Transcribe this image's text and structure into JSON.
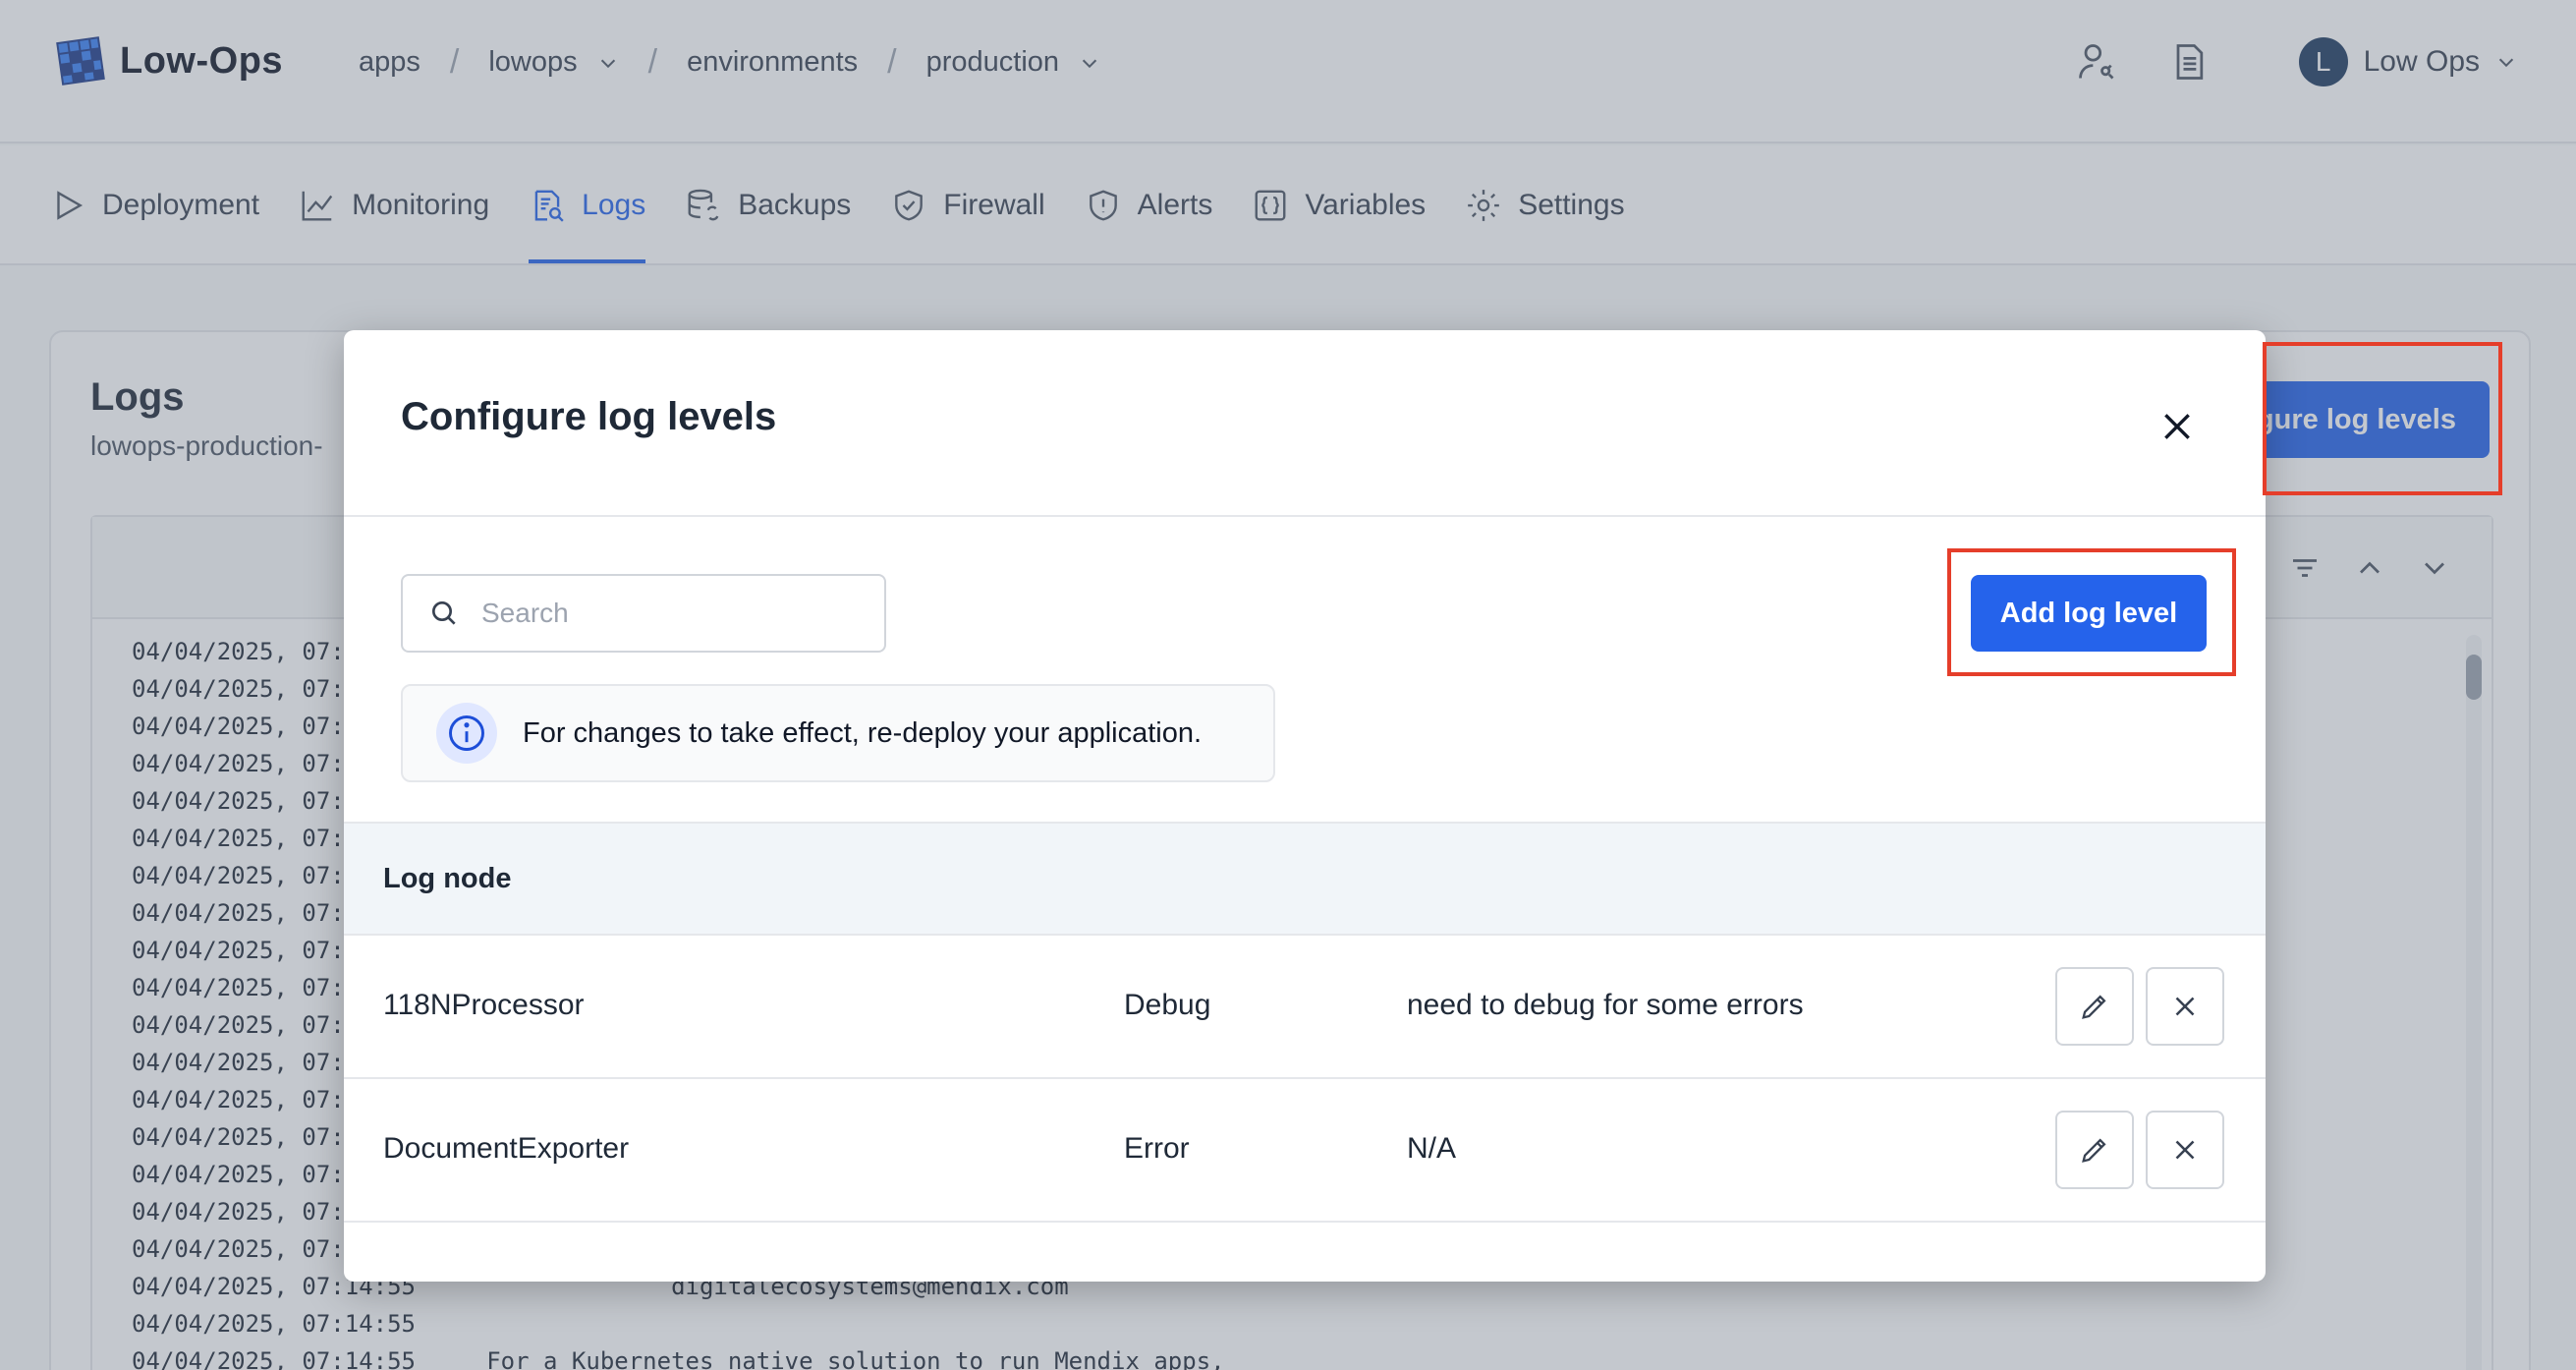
{
  "header": {
    "logo_text": "Low-Ops",
    "breadcrumbs": [
      {
        "label": "apps"
      },
      {
        "label": "lowops"
      },
      {
        "label": "environments"
      },
      {
        "label": "production"
      }
    ],
    "user_initial": "L",
    "user_name": "Low Ops"
  },
  "tabs": [
    {
      "label": "Deployment",
      "icon": "play-icon"
    },
    {
      "label": "Monitoring",
      "icon": "chart-icon"
    },
    {
      "label": "Logs",
      "icon": "logs-icon",
      "active": true
    },
    {
      "label": "Backups",
      "icon": "database-sync-icon"
    },
    {
      "label": "Firewall",
      "icon": "shield-check-icon"
    },
    {
      "label": "Alerts",
      "icon": "shield-alert-icon"
    },
    {
      "label": "Variables",
      "icon": "braces-icon"
    },
    {
      "label": "Settings",
      "icon": "gear-icon"
    }
  ],
  "logs_card": {
    "title": "Logs",
    "subtitle": "lowops-production-",
    "configure_button": "gure log levels",
    "lines": [
      "04/04/2025, 07:",
      "04/04/2025, 07:",
      "04/04/2025, 07:",
      "04/04/2025, 07:",
      "04/04/2025, 07:",
      "04/04/2025, 07:",
      "04/04/2025, 07:",
      "04/04/2025, 07:",
      "04/04/2025, 07:",
      "04/04/2025, 07:",
      "04/04/2025, 07:",
      "04/04/2025, 07:",
      "04/04/2025, 07:",
      "04/04/2025, 07:",
      "04/04/2025, 07:",
      "04/04/2025, 07:",
      "04/04/2025, 07:",
      "04/04/2025, 07:14:55                  digitalecosystems@mendix.com",
      "04/04/2025, 07:14:55",
      "04/04/2025, 07:14:55     For a Kubernetes native solution to run Mendix apps,"
    ]
  },
  "modal": {
    "title": "Configure log levels",
    "search_placeholder": "Search",
    "add_button": "Add log level",
    "info_text": "For changes to take effect, re-deploy your application.",
    "table_header": "Log node",
    "rows": [
      {
        "node": "118NProcessor",
        "level": "Debug",
        "comment": "need to debug for some errors"
      },
      {
        "node": "DocumentExporter",
        "level": "Error",
        "comment": "N/A"
      }
    ]
  },
  "colors": {
    "accent": "#2563eb",
    "highlight": "#e53e2a"
  }
}
